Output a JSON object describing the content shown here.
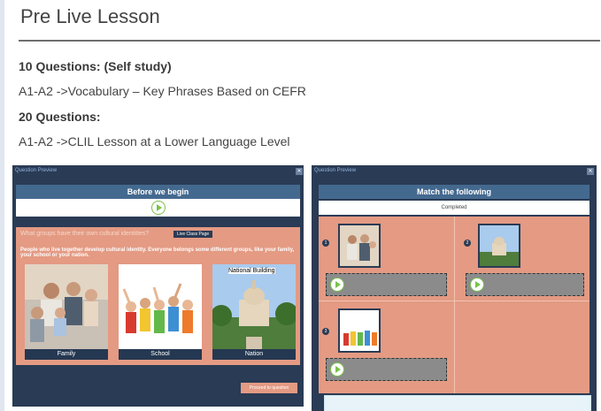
{
  "page": {
    "title": "Pre Live Lesson",
    "q10_heading": "10 Questions: (Self study)",
    "q10_desc": "A1-A2 ->Vocabulary – Key Phrases Based on CEFR",
    "q20_heading": "20 Questions:",
    "q20_desc": "A1-A2 ->CLIL Lesson at a Lower Language Level"
  },
  "left_shot": {
    "preview_label": "Question Preview",
    "heading": "Before we begin",
    "question": "What groups have their own cultural identities?",
    "live_class_btn": "Live Class Page",
    "info": "People who live together develop cultural identity. Everyone belongs some different groups, like your family, your school or your nation.",
    "cards": [
      "Family",
      "School",
      "Nation"
    ],
    "building_tag": "National Building",
    "proceed_btn": "Proceed to question"
  },
  "right_shot": {
    "preview_label": "Question Preview",
    "heading": "Match the following",
    "status": "Completed",
    "numbers": [
      "1",
      "2",
      "3"
    ]
  },
  "colors": {
    "accent": "#44698f",
    "peach": "#e49a83",
    "navy": "#2a3b55",
    "play": "#79c24a"
  }
}
